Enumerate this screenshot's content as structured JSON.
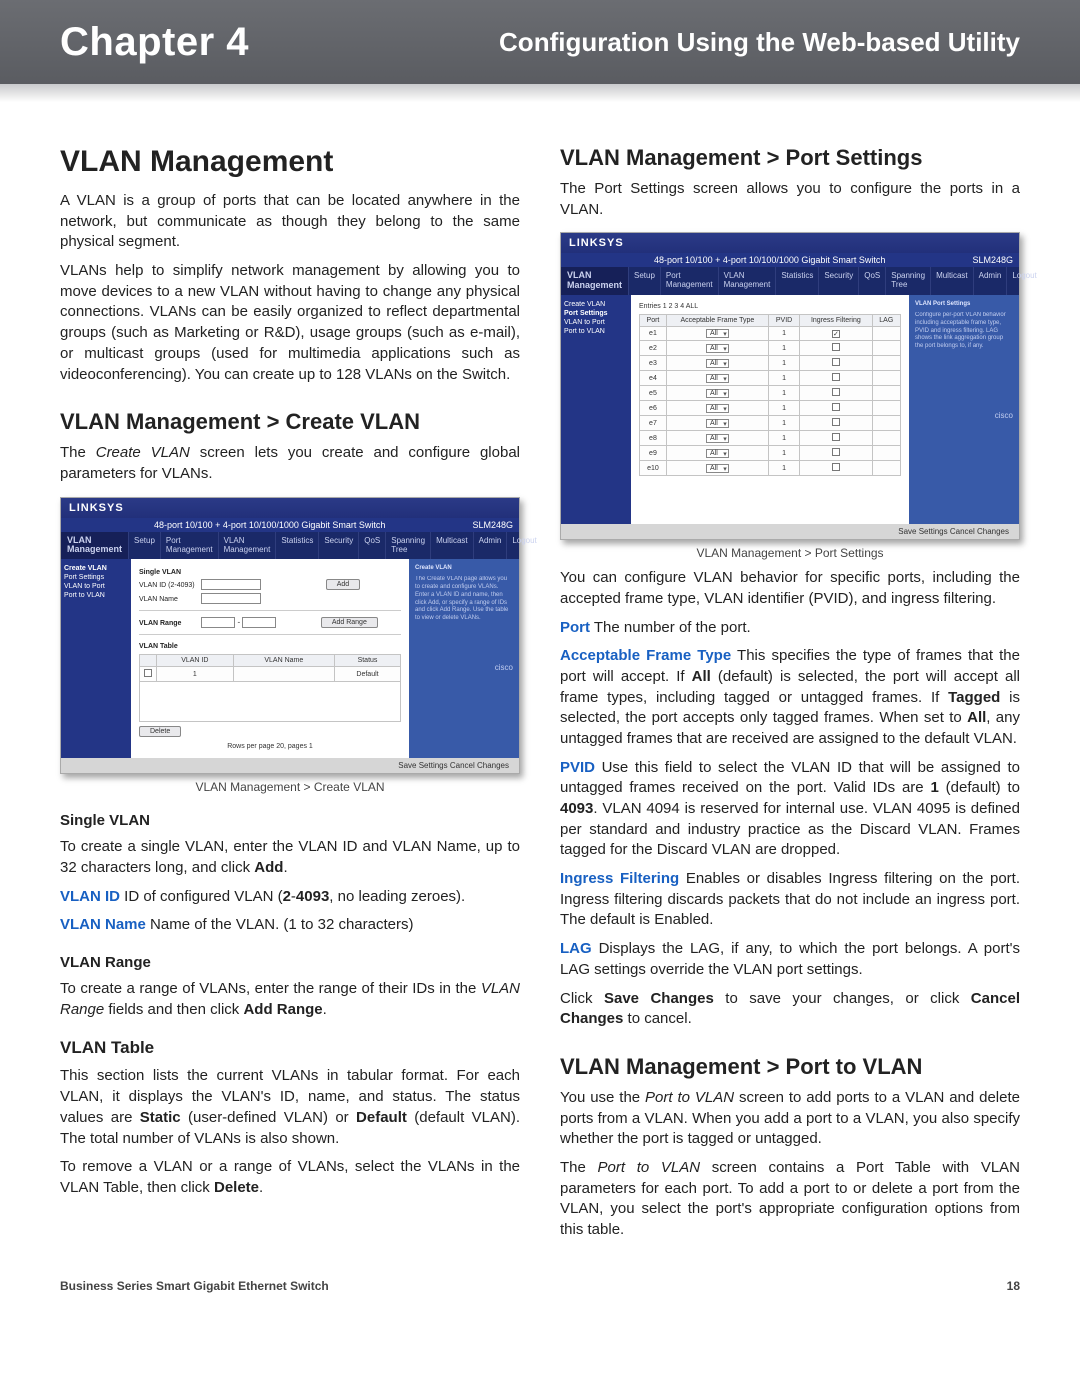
{
  "header": {
    "chapter": "Chapter 4",
    "section": "Configuration Using the Web-based Utility"
  },
  "left": {
    "h_main": "VLAN Management",
    "p1": "A VLAN is a group of ports that can be located anywhere in the network, but communicate as though they belong to the same physical segment.",
    "p2": "VLANs help to simplify network management by allowing you to move devices to a new VLAN without having to change any physical connections. VLANs can be easily organized to reflect departmental groups (such as Marketing or R&D), usage groups (such as e-mail), or multicast groups (used for multimedia applications such as videoconferencing). You can create up to 128 VLANs on the Switch.",
    "h_create": "VLAN Management > Create VLAN",
    "p3_a": "The ",
    "p3_i": "Create VLAN",
    "p3_b": " screen lets you create and configure global parameters for VLANs.",
    "fig1": {
      "brand": "LINKSYS",
      "device_right": "48-port 10/100 + 4-port 10/100/1000 Gigabit Smart Switch",
      "model": "SLM248G",
      "nav_label": "VLAN\nManagement",
      "tabs": [
        "Setup",
        "Port Management",
        "VLAN Management",
        "Statistics",
        "Security",
        "QoS",
        "Spanning Tree",
        "Multicast",
        "Admin",
        "Logout"
      ],
      "side_items": [
        "Create VLAN",
        "Port Settings",
        "VLAN to Port",
        "Port to VLAN"
      ],
      "single_label": "Single VLAN",
      "vlan_id_label": "VLAN ID (2-4093)",
      "vlan_name_label": "VLAN Name",
      "add_btn": "Add",
      "range_label": "VLAN Range",
      "addrange_btn": "Add Range",
      "table_label": "VLAN Table",
      "tbl_headers": [
        "VLAN ID",
        "VLAN Name",
        "Status"
      ],
      "row_vlanid": "1",
      "row_status": "Default",
      "rows_msg": "Rows per page 20, pages 1",
      "delete_btn": "Delete",
      "footer": "Save Settings  Cancel Changes",
      "help_title": "Create VLAN",
      "caption": "VLAN Management > Create VLAN"
    },
    "h_single": "Single VLAN",
    "p4_a": "To create a single VLAN, enter the VLAN ID and VLAN Name, up to 32 characters long,  and click ",
    "p4_bold": "Add",
    "p4_b": ".",
    "term_vlanid": "VLAN ID",
    "p5_a": "  ID of configured VLAN (",
    "p5_bold1": "2",
    "p5_mid": "-",
    "p5_bold2": "4093",
    "p5_b": ", no leading zeroes).",
    "term_vlanname": "VLAN Name",
    "p6": "  Name of the VLAN. (1 to 32 characters)",
    "h_range": "VLAN Range",
    "p7_a": "To create a range of VLANs, enter the range of their IDs in the ",
    "p7_i": "VLAN Range",
    "p7_b": " fields and then click ",
    "p7_bold": "Add Range",
    "p7_c": ".",
    "h_table": "VLAN Table",
    "p8_a": "This section lists the current VLANs in tabular format. For each VLAN, it displays the VLAN's ID, name, and status. The status values are ",
    "p8_bold1": "Static",
    "p8_b": " (user-defined VLAN) or ",
    "p8_bold2": "Default",
    "p8_c": " (default VLAN). The total number of VLANs is also shown.",
    "p9_a": "To remove a VLAN or a range of VLANs, select the VLANs in the VLAN Table, then click ",
    "p9_bold": "Delete",
    "p9_b": "."
  },
  "right": {
    "h_port": "VLAN Management > Port Settings",
    "p1": "The Port Settings screen allows you to configure the ports in a VLAN.",
    "fig2": {
      "brand": "LINKSYS",
      "device_right": "48-port 10/100 + 4-port 10/100/1000 Gigabit Smart Switch",
      "model": "SLM248G",
      "nav_label": "VLAN\nManagement",
      "tabs": [
        "Setup",
        "Port Management",
        "VLAN Management",
        "Statistics",
        "Security",
        "QoS",
        "Spanning Tree",
        "Multicast",
        "Admin",
        "Logout"
      ],
      "side_items": [
        "Create VLAN",
        "Port Settings",
        "VLAN to Port",
        "Port to VLAN"
      ],
      "entries": "Entries  1  2  3  4  ALL",
      "tbl_headers": [
        "Port",
        "Acceptable Frame Type",
        "PVID",
        "Ingress Filtering",
        "LAG"
      ],
      "rows": [
        {
          "port": "e1",
          "aft": "All",
          "pvid": "1",
          "ing": true
        },
        {
          "port": "e2",
          "aft": "All",
          "pvid": "1",
          "ing": false
        },
        {
          "port": "e3",
          "aft": "All",
          "pvid": "1",
          "ing": false
        },
        {
          "port": "e4",
          "aft": "All",
          "pvid": "1",
          "ing": false
        },
        {
          "port": "e5",
          "aft": "All",
          "pvid": "1",
          "ing": false
        },
        {
          "port": "e6",
          "aft": "All",
          "pvid": "1",
          "ing": false
        },
        {
          "port": "e7",
          "aft": "All",
          "pvid": "1",
          "ing": false
        },
        {
          "port": "e8",
          "aft": "All",
          "pvid": "1",
          "ing": false
        },
        {
          "port": "e9",
          "aft": "All",
          "pvid": "1",
          "ing": false
        },
        {
          "port": "e10",
          "aft": "All",
          "pvid": "1",
          "ing": false
        }
      ],
      "footer": "Save Settings  Cancel Changes",
      "help_title": "VLAN Port Settings",
      "caption": "VLAN Management > Port Settings"
    },
    "p2": "You can configure VLAN behavior for specific ports, including the accepted frame type, VLAN identifier (PVID), and ingress filtering.",
    "term_port": "Port",
    "p_port": "  The number of the port.",
    "term_aft": "Acceptable Frame Type",
    "p_aft_a": "  This specifies the type of frames that the port will accept. If ",
    "p_aft_b1": "All",
    "p_aft_b": " (default) is selected, the port will accept all frame types, including tagged or untagged frames. If ",
    "p_aft_b2": "Tagged",
    "p_aft_c": " is selected, the port accepts only tagged frames. When set to ",
    "p_aft_b3": "All",
    "p_aft_d": ", any untagged frames that are received are assigned to the default VLAN.",
    "term_pvid": "PVID",
    "p_pvid_a": "  Use this field to select the VLAN ID that will be assigned to untagged frames received on the port. Valid IDs are ",
    "p_pvid_b1": "1",
    "p_pvid_b": " (default) to ",
    "p_pvid_b2": "4093",
    "p_pvid_c": ". VLAN 4094 is reserved for internal use. VLAN 4095 is defined per standard and industry practice as the Discard VLAN. Frames tagged for the Discard VLAN are dropped.",
    "term_if": "Ingress Filtering",
    "p_if": "  Enables or disables Ingress filtering on the port. Ingress filtering discards packets that do not include an ingress port. The default is Enabled.",
    "term_lag": "LAG",
    "p_lag": "  Displays the LAG, if any, to which the port belongs. A port's LAG settings override the VLAN port settings.",
    "p_save_a": "Click ",
    "p_save_b1": "Save Changes",
    "p_save_b": " to save your changes, or click ",
    "p_save_b2": "Cancel Changes",
    "p_save_c": " to cancel.",
    "h_p2v": "VLAN Management > Port to VLAN",
    "p_p2v1_a": "You use the ",
    "p_p2v1_i": "Port to VLAN",
    "p_p2v1_b": " screen to add ports to a VLAN and delete ports from a VLAN. When you add a port to a VLAN, you also specify whether the port is tagged or untagged.",
    "p_p2v2_a": "The ",
    "p_p2v2_i": "Port to VLAN",
    "p_p2v2_b": " screen contains a Port Table with VLAN parameters for each port. To add a port to or delete a port from the VLAN, you select the port's appropriate configuration options from this table."
  },
  "footer": {
    "left": "Business Series Smart Gigabit Ethernet Switch",
    "right": "18"
  }
}
